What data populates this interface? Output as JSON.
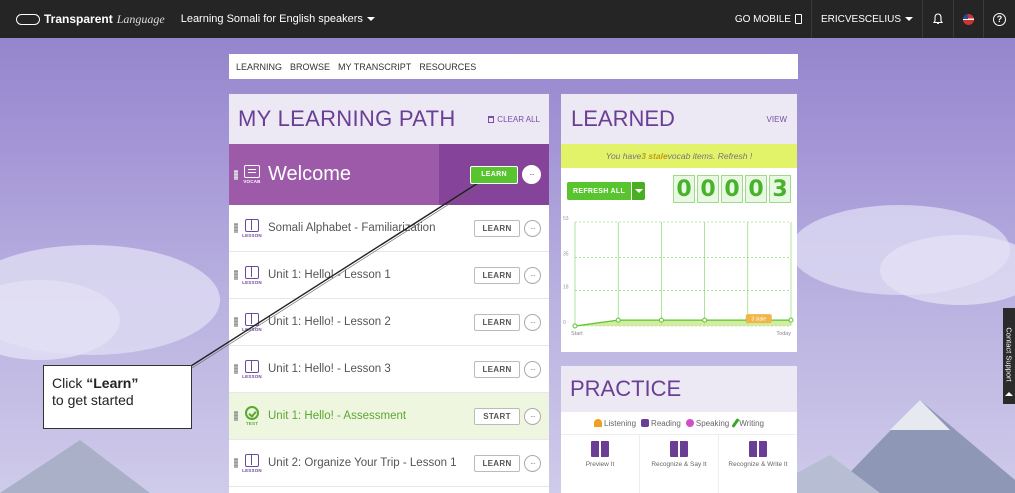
{
  "topbar": {
    "logo_strong": "Transparent",
    "logo_em": "Language",
    "course": "Learning Somali for English speakers",
    "go_mobile": "GO MOBILE",
    "user": "ERICVESCELIUS",
    "help": "?"
  },
  "subnav": {
    "items": [
      "LEARNING",
      "BROWSE",
      "MY TRANSCRIPT",
      "RESOURCES"
    ]
  },
  "learning_path": {
    "title": "MY LEARNING PATH",
    "clear_all": "CLEAR ALL",
    "items": [
      {
        "type": "VOCAB",
        "title": "Welcome",
        "action": "LEARN"
      },
      {
        "type": "LESSON",
        "title": "Somali Alphabet - Familiarization",
        "action": "LEARN"
      },
      {
        "type": "LESSON",
        "title": "Unit 1: Hello! - Lesson 1",
        "action": "LEARN"
      },
      {
        "type": "LESSON",
        "title": "Unit 1: Hello! - Lesson 2",
        "action": "LEARN"
      },
      {
        "type": "LESSON",
        "title": "Unit 1: Hello! - Lesson 3",
        "action": "LEARN"
      },
      {
        "type": "TEST",
        "title": "Unit 1: Hello! - Assessment",
        "action": "START"
      },
      {
        "type": "LESSON",
        "title": "Unit 2: Organize Your Trip - Lesson 1",
        "action": "LEARN"
      }
    ],
    "more": "···"
  },
  "learned": {
    "title": "LEARNED",
    "view": "VIEW",
    "stale_pre": "You have ",
    "stale_count": "3 stale",
    "stale_post": " vocab items. Refresh !",
    "refresh_all": "REFRESH ALL",
    "digits": [
      "0",
      "0",
      "0",
      "0",
      "3"
    ]
  },
  "chart_data": {
    "type": "line",
    "y_ticks": [
      "53",
      "35",
      "18",
      "0"
    ],
    "x_labels": [
      "Start",
      "Today"
    ],
    "x": [
      "Start",
      "",
      "",
      "",
      "",
      "Today"
    ],
    "values": [
      0,
      3,
      3,
      3,
      3,
      3
    ],
    "ylim": [
      0,
      53
    ],
    "annotation": "3 stale"
  },
  "practice": {
    "title": "PRACTICE",
    "skills": [
      "Listening",
      "Reading",
      "Speaking",
      "Writing"
    ],
    "modes": [
      "Preview It",
      "Recognize & Say It",
      "Recognize & Write It"
    ]
  },
  "callout": {
    "line1_pre": "Click ",
    "line1_bold": "“Learn”",
    "line2": "to get started"
  },
  "contact_support": "Contact Support",
  "colors": {
    "accent_purple": "#6b3e95",
    "featured_bg": "#9c5aa8",
    "green": "#59c52e",
    "stale_yellow": "#e2f36a"
  }
}
